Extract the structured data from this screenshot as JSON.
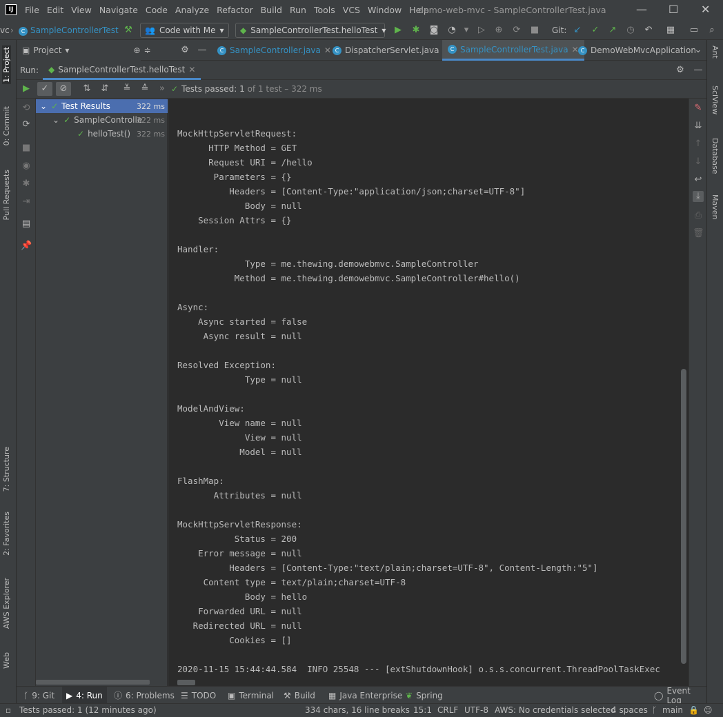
{
  "menu": {
    "items": [
      "File",
      "Edit",
      "View",
      "Navigate",
      "Code",
      "Analyze",
      "Refactor",
      "Build",
      "Run",
      "Tools",
      "VCS",
      "Window",
      "Help"
    ],
    "window_title": "demo-web-mvc - SampleControllerTest.java"
  },
  "toolbar": {
    "breadcrumb_prefix": "vc",
    "breadcrumb_class": "SampleControllerTest",
    "code_with_me": "Code with Me",
    "run_config": "SampleControllerTest.helloTest",
    "git_label": "Git:"
  },
  "project_tab": {
    "label": "Project"
  },
  "editor_tabs": [
    {
      "label": "SampleController.java",
      "active": false
    },
    {
      "label": "DispatcherServlet.java",
      "active": false
    },
    {
      "label": "SampleControllerTest.java",
      "active": true
    },
    {
      "label": "DemoWebMvcApplication",
      "active": false
    }
  ],
  "run": {
    "label": "Run:",
    "tab_label": "SampleControllerTest.helloTest",
    "status_prefix": "Tests passed:",
    "status_count": "1",
    "status_suffix": "of 1 test – 322 ms"
  },
  "tree": [
    {
      "label": "Test Results",
      "time": "322 ms"
    },
    {
      "label": "SampleControlle",
      "time": "322 ms"
    },
    {
      "label": "helloTest()",
      "time": "322 ms"
    }
  ],
  "console_lines": [
    "MockHttpServletRequest:",
    "      HTTP Method = GET",
    "      Request URI = /hello",
    "       Parameters = {}",
    "          Headers = [Content-Type:\"application/json;charset=UTF-8\"]",
    "             Body = null",
    "    Session Attrs = {}",
    "",
    "Handler:",
    "             Type = me.thewing.demowebmvc.SampleController",
    "           Method = me.thewing.demowebmvc.SampleController#hello()",
    "",
    "Async:",
    "    Async started = false",
    "     Async result = null",
    "",
    "Resolved Exception:",
    "             Type = null",
    "",
    "ModelAndView:",
    "        View name = null",
    "             View = null",
    "            Model = null",
    "",
    "FlashMap:",
    "       Attributes = null",
    "",
    "MockHttpServletResponse:",
    "           Status = 200",
    "    Error message = null",
    "          Headers = [Content-Type:\"text/plain;charset=UTF-8\", Content-Length:\"5\"]",
    "     Content type = text/plain;charset=UTF-8",
    "             Body = hello",
    "    Forwarded URL = null",
    "   Redirected URL = null",
    "          Cookies = []",
    "",
    "2020-11-15 15:44:44.584  INFO 25548 --- [extShutdownHook] o.s.s.concurrent.ThreadPoolTaskExec"
  ],
  "left_strip": [
    "1: Project",
    "0: Commit",
    "Pull Requests",
    "7: Structure",
    "2: Favorites",
    "AWS Explorer",
    "Web"
  ],
  "right_strip": [
    "Ant",
    "SciView",
    "Database",
    "Maven"
  ],
  "bottom_tabs": [
    "9: Git",
    "4: Run",
    "6: Problems",
    "TODO",
    "Terminal",
    "Build",
    "Java Enterprise",
    "Spring",
    "Event Log"
  ],
  "status": {
    "message": "Tests passed: 1 (12 minutes ago)",
    "chars": "334 chars, 16 line breaks",
    "position": "15:1",
    "line_sep": "CRLF",
    "encoding": "UTF-8",
    "aws": "AWS: No credentials selected",
    "indent": "4 spaces",
    "branch": "main"
  }
}
